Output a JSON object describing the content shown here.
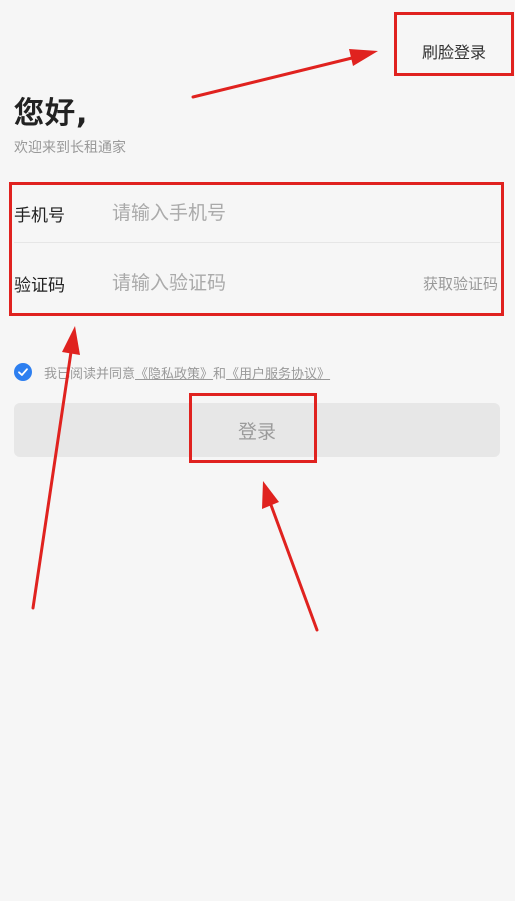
{
  "header": {
    "face_login_label": "刷脸登录"
  },
  "intro": {
    "greeting": "您好,",
    "welcome": "欢迎来到长租通家"
  },
  "form": {
    "phone": {
      "label": "手机号",
      "placeholder": "请输入手机号",
      "value": ""
    },
    "code": {
      "label": "验证码",
      "placeholder": "请输入验证码",
      "value": "",
      "get_code_label": "获取验证码"
    }
  },
  "agreement": {
    "checked": true,
    "prefix": "我已阅读并同意",
    "privacy_link": "《隐私政策》",
    "conjunction": "和",
    "service_link": "《用户服务协议》"
  },
  "login_button": {
    "label": "登录"
  },
  "colors": {
    "background": "#f6f6f6",
    "accent": "#2d7ff0",
    "annotation": "#e0221f",
    "button_bg": "#e7e7e7"
  }
}
